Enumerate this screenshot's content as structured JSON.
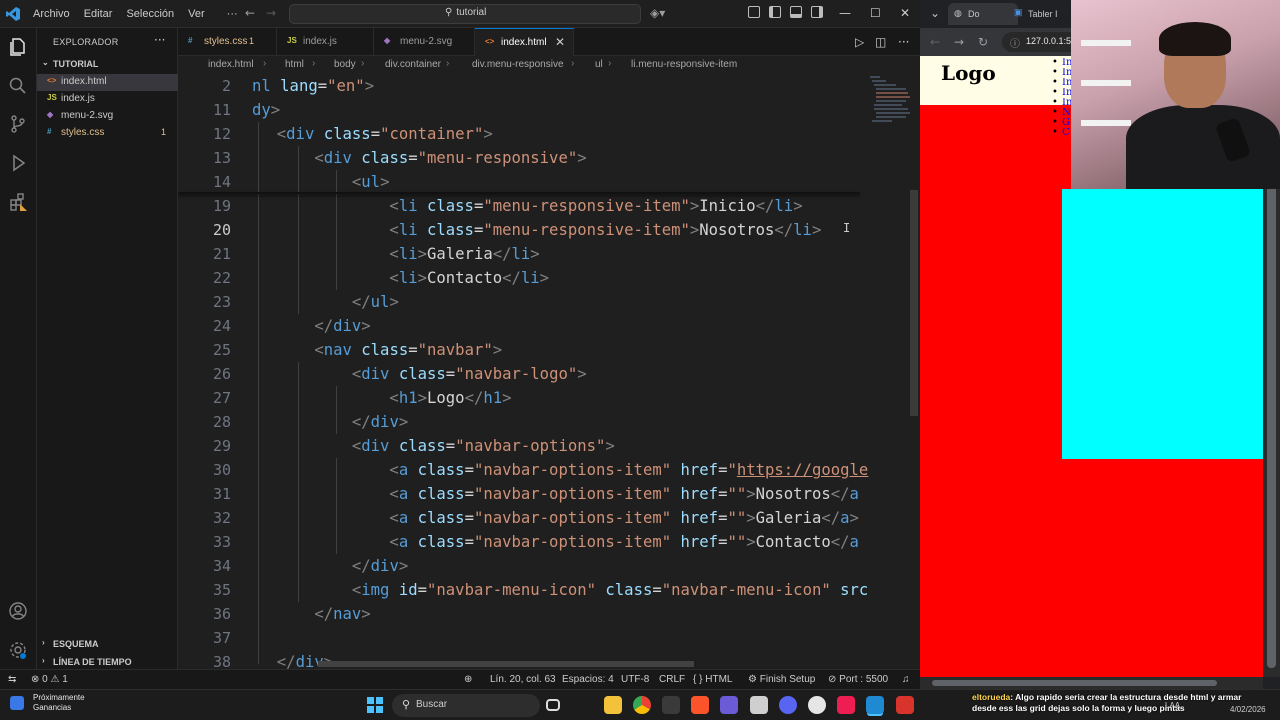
{
  "titlebar": {
    "menus": [
      "Archivo",
      "Editar",
      "Selección",
      "Ver"
    ],
    "more": "···",
    "search_text": "tutorial"
  },
  "sidebar": {
    "title": "EXPLORADOR",
    "more": "···",
    "folder": "TUTORIAL",
    "files": [
      {
        "icon": "<>",
        "name": "index.html",
        "active": true,
        "color": "#e37933",
        "badge": ""
      },
      {
        "icon": "JS",
        "name": "index.js",
        "active": false,
        "color": "#cbcb41",
        "badge": ""
      },
      {
        "icon": "◆",
        "name": "menu-2.svg",
        "active": false,
        "color": "#a074c4",
        "badge": ""
      },
      {
        "icon": "#",
        "name": "styles.css",
        "active": false,
        "color": "#519aba",
        "badge": "1"
      }
    ],
    "sections": [
      "ESQUEMA",
      "LÍNEA DE TIEMPO"
    ]
  },
  "tabs": [
    {
      "icon": "#",
      "label": "styles.css",
      "badge": "1",
      "color": "#519aba",
      "active": false
    },
    {
      "icon": "JS",
      "label": "index.js",
      "badge": "",
      "color": "#cbcb41",
      "active": false
    },
    {
      "icon": "◆",
      "label": "menu-2.svg",
      "badge": "",
      "color": "#a074c4",
      "active": false
    },
    {
      "icon": "<>",
      "label": "index.html",
      "badge": "",
      "color": "#e37933",
      "active": true
    }
  ],
  "breadcrumb": [
    "index.html",
    "html",
    "body",
    "div.container",
    "div.menu-responsive",
    "ul",
    "li.menu-responsive-item"
  ],
  "code_lines": [
    {
      "num": "2",
      "tokens": [
        [
          "t-tag",
          "nl"
        ],
        [
          "t-txt",
          " "
        ],
        [
          "t-attr",
          "lang"
        ],
        [
          "t-txt",
          "="
        ],
        [
          "t-str",
          "\"en\""
        ],
        [
          "t-br",
          ">"
        ]
      ]
    },
    {
      "num": "11",
      "tokens": [
        [
          "t-tag",
          "dy"
        ],
        [
          "t-br",
          ">"
        ]
      ]
    },
    {
      "num": "12",
      "tokens": [
        [
          "t-br",
          "  <"
        ],
        [
          "t-tag",
          "div"
        ],
        [
          "t-txt",
          " "
        ],
        [
          "t-attr",
          "class"
        ],
        [
          "t-txt",
          "="
        ],
        [
          "t-str",
          "\"container\""
        ],
        [
          "t-br",
          ">"
        ]
      ]
    },
    {
      "num": "13",
      "tokens": [
        [
          "t-br",
          "      <"
        ],
        [
          "t-tag",
          "div"
        ],
        [
          "t-txt",
          " "
        ],
        [
          "t-attr",
          "class"
        ],
        [
          "t-txt",
          "="
        ],
        [
          "t-str",
          "\"menu-responsive\""
        ],
        [
          "t-br",
          ">"
        ]
      ]
    },
    {
      "num": "14",
      "tokens": [
        [
          "t-br",
          "          <"
        ],
        [
          "t-tag",
          "ul"
        ],
        [
          "t-br",
          ">"
        ]
      ]
    },
    {
      "num": "19",
      "tokens": [
        [
          "t-br",
          "              <"
        ],
        [
          "t-tag",
          "li"
        ],
        [
          "t-txt",
          " "
        ],
        [
          "t-attr",
          "class"
        ],
        [
          "t-txt",
          "="
        ],
        [
          "t-str",
          "\"menu-responsive-item\""
        ],
        [
          "t-br",
          ">"
        ],
        [
          "t-txt",
          "Inicio"
        ],
        [
          "t-br",
          "</"
        ],
        [
          "t-tag",
          "li"
        ],
        [
          "t-br",
          ">"
        ]
      ]
    },
    {
      "num": "20",
      "current": true,
      "tokens": [
        [
          "t-br",
          "              <"
        ],
        [
          "t-tag",
          "li"
        ],
        [
          "t-txt",
          " "
        ],
        [
          "t-attr",
          "class"
        ],
        [
          "t-txt",
          "="
        ],
        [
          "t-str",
          "\"menu-responsive-item\""
        ],
        [
          "t-br",
          ">"
        ],
        [
          "t-txt",
          "Nosotros"
        ],
        [
          "t-br",
          "</"
        ],
        [
          "t-tag",
          "li"
        ],
        [
          "t-br",
          ">"
        ]
      ]
    },
    {
      "num": "21",
      "tokens": [
        [
          "t-br",
          "              <"
        ],
        [
          "t-tag",
          "li"
        ],
        [
          "t-br",
          ">"
        ],
        [
          "t-txt",
          "Galeria"
        ],
        [
          "t-br",
          "</"
        ],
        [
          "t-tag",
          "li"
        ],
        [
          "t-br",
          ">"
        ]
      ]
    },
    {
      "num": "22",
      "tokens": [
        [
          "t-br",
          "              <"
        ],
        [
          "t-tag",
          "li"
        ],
        [
          "t-br",
          ">"
        ],
        [
          "t-txt",
          "Contacto"
        ],
        [
          "t-br",
          "</"
        ],
        [
          "t-tag",
          "li"
        ],
        [
          "t-br",
          ">"
        ]
      ]
    },
    {
      "num": "23",
      "tokens": [
        [
          "t-br",
          "          </"
        ],
        [
          "t-tag",
          "ul"
        ],
        [
          "t-br",
          ">"
        ]
      ]
    },
    {
      "num": "24",
      "tokens": [
        [
          "t-br",
          "      </"
        ],
        [
          "t-tag",
          "div"
        ],
        [
          "t-br",
          ">"
        ]
      ]
    },
    {
      "num": "25",
      "tokens": [
        [
          "t-br",
          "      <"
        ],
        [
          "t-tag",
          "nav"
        ],
        [
          "t-txt",
          " "
        ],
        [
          "t-attr",
          "class"
        ],
        [
          "t-txt",
          "="
        ],
        [
          "t-str",
          "\"navbar\""
        ],
        [
          "t-br",
          ">"
        ]
      ]
    },
    {
      "num": "26",
      "tokens": [
        [
          "t-br",
          "          <"
        ],
        [
          "t-tag",
          "div"
        ],
        [
          "t-txt",
          " "
        ],
        [
          "t-attr",
          "class"
        ],
        [
          "t-txt",
          "="
        ],
        [
          "t-str",
          "\"navbar-logo\""
        ],
        [
          "t-br",
          ">"
        ]
      ]
    },
    {
      "num": "27",
      "tokens": [
        [
          "t-br",
          "              <"
        ],
        [
          "t-tag",
          "h1"
        ],
        [
          "t-br",
          ">"
        ],
        [
          "t-txt",
          "Logo"
        ],
        [
          "t-br",
          "</"
        ],
        [
          "t-tag",
          "h1"
        ],
        [
          "t-br",
          ">"
        ]
      ]
    },
    {
      "num": "28",
      "tokens": [
        [
          "t-br",
          "          </"
        ],
        [
          "t-tag",
          "div"
        ],
        [
          "t-br",
          ">"
        ]
      ]
    },
    {
      "num": "29",
      "tokens": [
        [
          "t-br",
          "          <"
        ],
        [
          "t-tag",
          "div"
        ],
        [
          "t-txt",
          " "
        ],
        [
          "t-attr",
          "class"
        ],
        [
          "t-txt",
          "="
        ],
        [
          "t-str",
          "\"navbar-options\""
        ],
        [
          "t-br",
          ">"
        ]
      ]
    },
    {
      "num": "30",
      "tokens": [
        [
          "t-br",
          "              <"
        ],
        [
          "t-tag",
          "a"
        ],
        [
          "t-txt",
          " "
        ],
        [
          "t-attr",
          "class"
        ],
        [
          "t-txt",
          "="
        ],
        [
          "t-str",
          "\"navbar-options-item\""
        ],
        [
          "t-txt",
          " "
        ],
        [
          "t-attr",
          "href"
        ],
        [
          "t-txt",
          "="
        ],
        [
          "t-str",
          "\""
        ],
        [
          "t-url",
          "https://google"
        ]
      ]
    },
    {
      "num": "31",
      "tokens": [
        [
          "t-br",
          "              <"
        ],
        [
          "t-tag",
          "a"
        ],
        [
          "t-txt",
          " "
        ],
        [
          "t-attr",
          "class"
        ],
        [
          "t-txt",
          "="
        ],
        [
          "t-str",
          "\"navbar-options-item\""
        ],
        [
          "t-txt",
          " "
        ],
        [
          "t-attr",
          "href"
        ],
        [
          "t-txt",
          "="
        ],
        [
          "t-str",
          "\"\""
        ],
        [
          "t-br",
          ">"
        ],
        [
          "t-txt",
          "Nosotros"
        ],
        [
          "t-br",
          "</"
        ],
        [
          "t-tag",
          "a"
        ]
      ]
    },
    {
      "num": "32",
      "tokens": [
        [
          "t-br",
          "              <"
        ],
        [
          "t-tag",
          "a"
        ],
        [
          "t-txt",
          " "
        ],
        [
          "t-attr",
          "class"
        ],
        [
          "t-txt",
          "="
        ],
        [
          "t-str",
          "\"navbar-options-item\""
        ],
        [
          "t-txt",
          " "
        ],
        [
          "t-attr",
          "href"
        ],
        [
          "t-txt",
          "="
        ],
        [
          "t-str",
          "\"\""
        ],
        [
          "t-br",
          ">"
        ],
        [
          "t-txt",
          "Galeria"
        ],
        [
          "t-br",
          "</"
        ],
        [
          "t-tag",
          "a"
        ],
        [
          "t-br",
          ">"
        ]
      ]
    },
    {
      "num": "33",
      "tokens": [
        [
          "t-br",
          "              <"
        ],
        [
          "t-tag",
          "a"
        ],
        [
          "t-txt",
          " "
        ],
        [
          "t-attr",
          "class"
        ],
        [
          "t-txt",
          "="
        ],
        [
          "t-str",
          "\"navbar-options-item\""
        ],
        [
          "t-txt",
          " "
        ],
        [
          "t-attr",
          "href"
        ],
        [
          "t-txt",
          "="
        ],
        [
          "t-str",
          "\"\""
        ],
        [
          "t-br",
          ">"
        ],
        [
          "t-txt",
          "Contacto"
        ],
        [
          "t-br",
          "</"
        ],
        [
          "t-tag",
          "a"
        ]
      ]
    },
    {
      "num": "34",
      "tokens": [
        [
          "t-br",
          "          </"
        ],
        [
          "t-tag",
          "div"
        ],
        [
          "t-br",
          ">"
        ]
      ]
    },
    {
      "num": "35",
      "tokens": [
        [
          "t-br",
          "          <"
        ],
        [
          "t-tag",
          "img"
        ],
        [
          "t-txt",
          " "
        ],
        [
          "t-attr",
          "id"
        ],
        [
          "t-txt",
          "="
        ],
        [
          "t-str",
          "\"navbar-menu-icon\""
        ],
        [
          "t-txt",
          " "
        ],
        [
          "t-attr",
          "class"
        ],
        [
          "t-txt",
          "="
        ],
        [
          "t-str",
          "\"navbar-menu-icon\""
        ],
        [
          "t-txt",
          " "
        ],
        [
          "t-attr",
          "src"
        ]
      ]
    },
    {
      "num": "36",
      "tokens": [
        [
          "t-br",
          "      </"
        ],
        [
          "t-tag",
          "nav"
        ],
        [
          "t-br",
          ">"
        ]
      ]
    },
    {
      "num": "37",
      "tokens": []
    },
    {
      "num": "38",
      "tokens": [
        [
          "t-br",
          "  </"
        ],
        [
          "t-tag",
          "div"
        ],
        [
          "t-br",
          ">"
        ]
      ]
    }
  ],
  "statusbar": {
    "errors": "0",
    "warnings": "1",
    "position": "Lín. 20, col. 63",
    "spaces": "Espacios: 4",
    "encoding": "UTF-8",
    "eol": "CRLF",
    "language": "HTML",
    "finish_setup": "Finish Setup",
    "port": "Port : 5500"
  },
  "browser": {
    "tabs": [
      "Do",
      "Tabler I"
    ],
    "url": "127.0.0.1:5",
    "page": {
      "logo": "Logo",
      "menu_items": [
        "In",
        "In",
        "In",
        "In",
        "In",
        "N",
        "G",
        "C"
      ],
      "colors": {
        "background": "#ff0000",
        "navbar": "#fffde6",
        "box": "#00ffff"
      }
    }
  },
  "taskbar": {
    "weather_line1": "Próximamente",
    "weather_line2": "Ganancias",
    "search_label": "Buscar",
    "chat_user": "eltorueda",
    "chat_text": ": Algo rapido seria crear la estructura desde html y armar desde ess las grid dejas solo la forma y luego pintas",
    "tray_lang": "LAA",
    "date": "4/02/2026"
  }
}
